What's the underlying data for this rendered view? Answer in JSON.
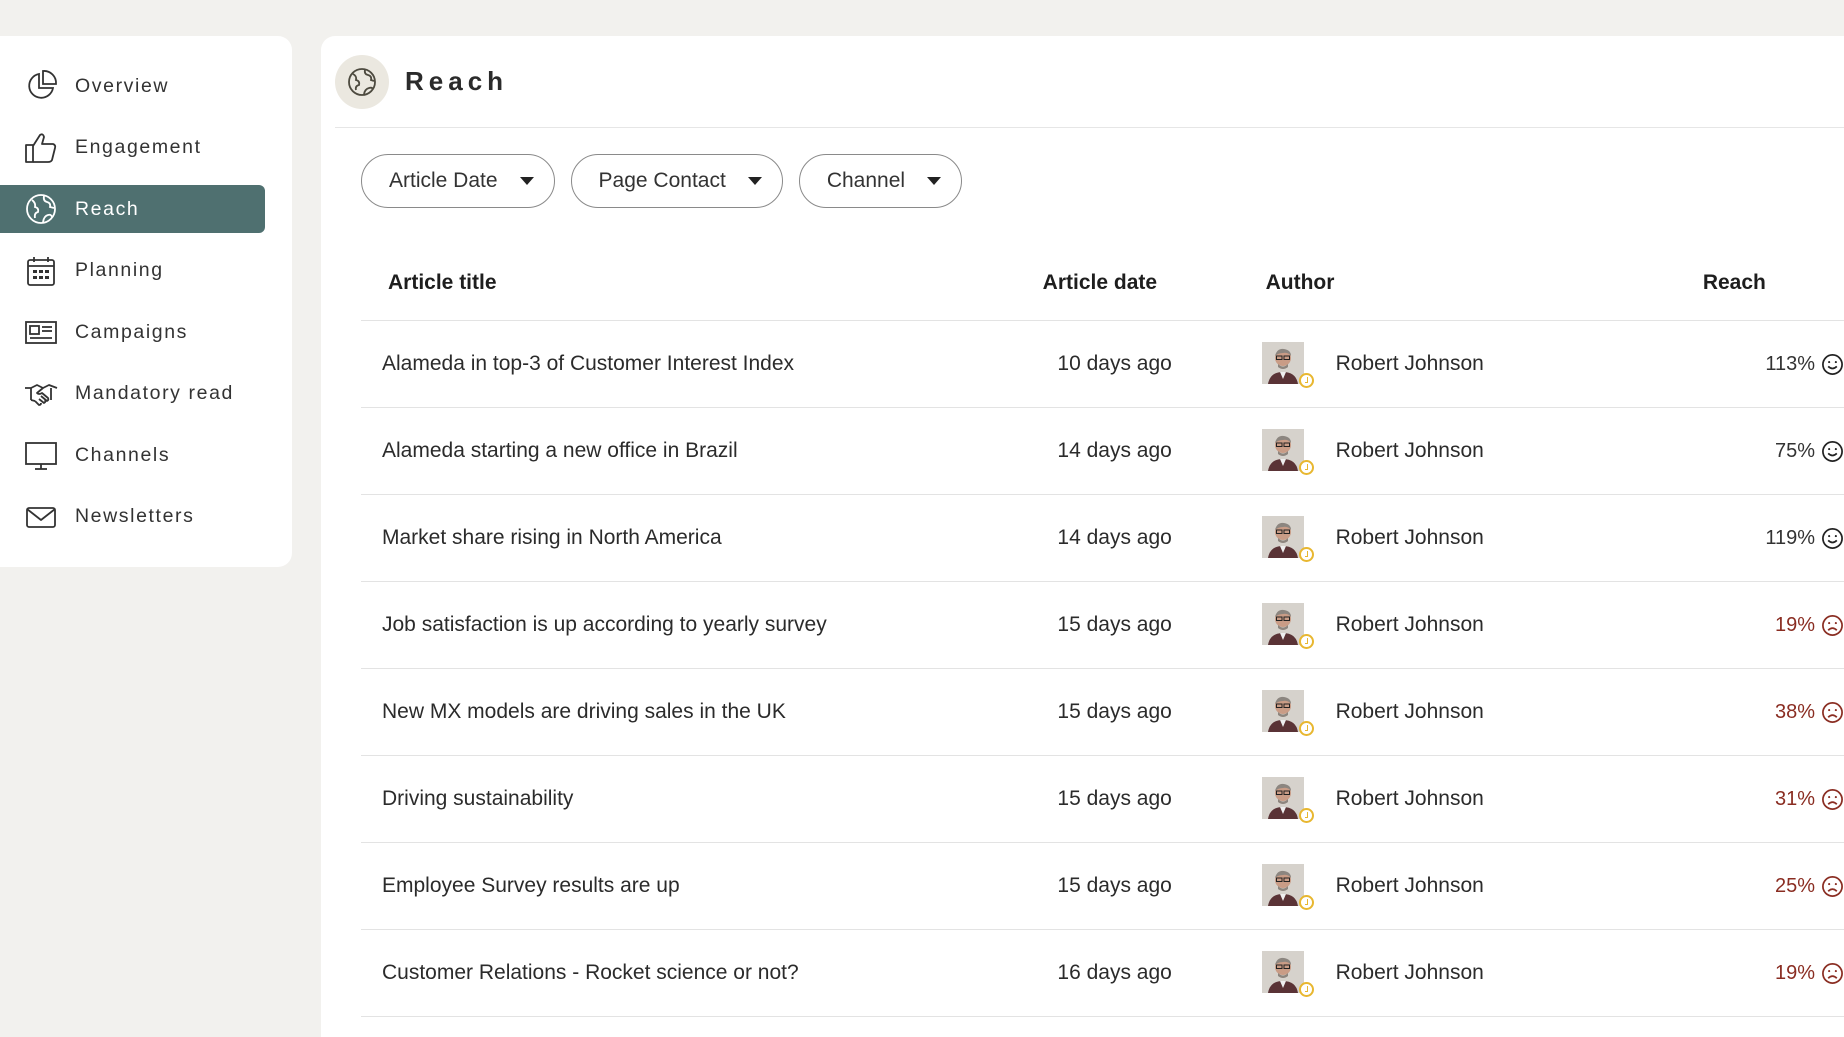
{
  "sidebar": {
    "items": [
      {
        "label": "Overview",
        "icon": "pie-chart-icon"
      },
      {
        "label": "Engagement",
        "icon": "thumbs-up-icon"
      },
      {
        "label": "Reach",
        "icon": "globe-icon",
        "active": true
      },
      {
        "label": "Planning",
        "icon": "calendar-icon"
      },
      {
        "label": "Campaigns",
        "icon": "newspaper-icon"
      },
      {
        "label": "Mandatory read",
        "icon": "handshake-icon"
      },
      {
        "label": "Channels",
        "icon": "monitor-icon"
      },
      {
        "label": "Newsletters",
        "icon": "envelope-icon"
      }
    ]
  },
  "header": {
    "title": "Reach",
    "icon": "globe-icon"
  },
  "filters": [
    {
      "label": "Article Date"
    },
    {
      "label": "Page Contact"
    },
    {
      "label": "Channel"
    }
  ],
  "table": {
    "columns": [
      "Article title",
      "Article date",
      "Author",
      "Reach"
    ],
    "rows": [
      {
        "title": "Alameda in top-3 of Customer Interest Index",
        "date": "10 days ago",
        "author": "Robert Johnson",
        "reach": "113%",
        "sentiment": "happy"
      },
      {
        "title": "Alameda starting a new office in Brazil",
        "date": "14 days ago",
        "author": "Robert Johnson",
        "reach": "75%",
        "sentiment": "happy"
      },
      {
        "title": "Market share rising in North America",
        "date": "14 days ago",
        "author": "Robert Johnson",
        "reach": "119%",
        "sentiment": "happy"
      },
      {
        "title": "Job satisfaction is up according to yearly survey",
        "date": "15 days ago",
        "author": "Robert Johnson",
        "reach": "19%",
        "sentiment": "sad"
      },
      {
        "title": "New MX models are driving sales in the UK",
        "date": "15 days ago",
        "author": "Robert Johnson",
        "reach": "38%",
        "sentiment": "sad"
      },
      {
        "title": "Driving sustainability",
        "date": "15 days ago",
        "author": "Robert Johnson",
        "reach": "31%",
        "sentiment": "sad"
      },
      {
        "title": "Employee Survey results are up",
        "date": "15 days ago",
        "author": "Robert Johnson",
        "reach": "25%",
        "sentiment": "sad"
      },
      {
        "title": "Customer Relations - Rocket science or not?",
        "date": "16 days ago",
        "author": "Robert Johnson",
        "reach": "19%",
        "sentiment": "sad"
      }
    ]
  },
  "colors": {
    "accent": "#4f7070",
    "negative": "#8a2d22",
    "status": "#e8b730",
    "background": "#f2f1ee"
  }
}
